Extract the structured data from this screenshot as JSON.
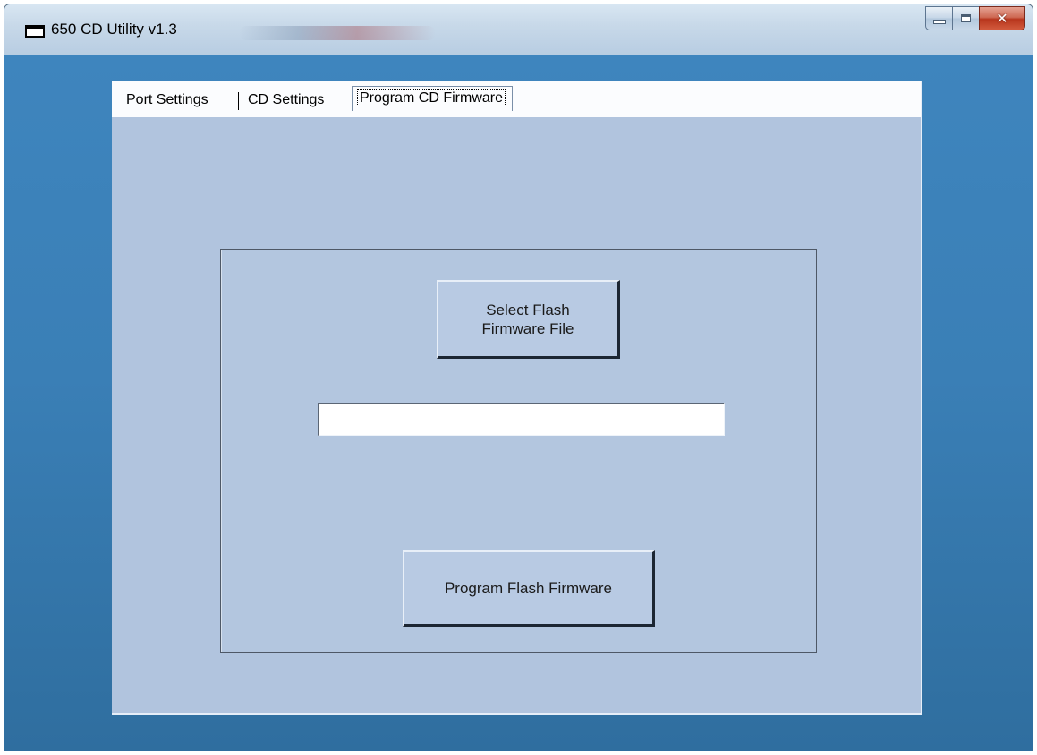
{
  "window": {
    "title": "650 CD Utility v1.3"
  },
  "tabs": [
    {
      "label": "Port Settings",
      "selected": false
    },
    {
      "label": "CD Settings",
      "selected": false
    },
    {
      "label": "Program CD Firmware",
      "selected": true
    }
  ],
  "program_firmware": {
    "select_button_label": "Select Flash\nFirmware File",
    "file_path_value": "",
    "program_button_label": "Program Flash Firmware"
  },
  "icons": {
    "app": "app-window-icon",
    "minimize": "minimize-icon",
    "maximize": "maximize-icon",
    "close": "close-icon"
  },
  "colors": {
    "frame": "#3f86bf",
    "client": "#b1c4de",
    "close_button": "#c4452b"
  }
}
